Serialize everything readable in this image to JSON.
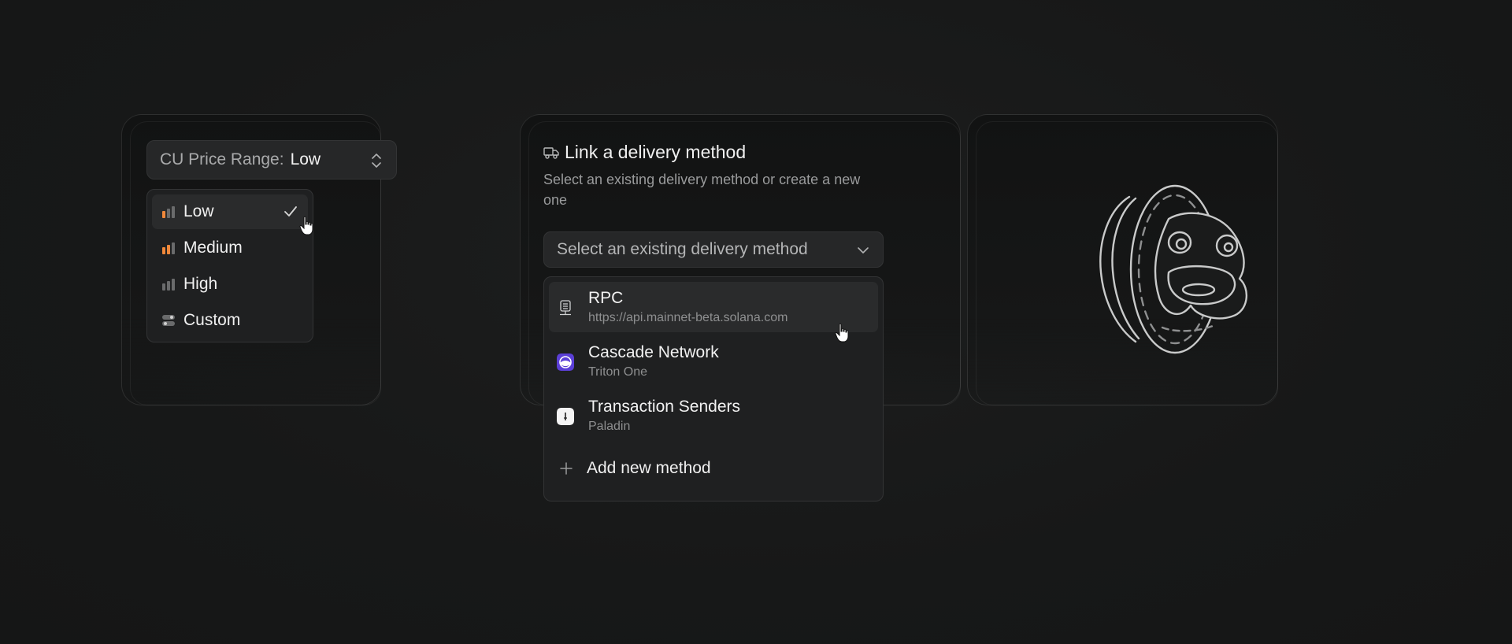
{
  "cu_price": {
    "label": "CU Price Range:",
    "value": "Low",
    "options": [
      {
        "label": "Low",
        "icon": "signal-bars-low-icon",
        "selected": true
      },
      {
        "label": "Medium",
        "icon": "signal-bars-medium-icon",
        "selected": false
      },
      {
        "label": "High",
        "icon": "signal-bars-high-icon",
        "selected": false
      },
      {
        "label": "Custom",
        "icon": "toggles-icon",
        "selected": false
      }
    ]
  },
  "delivery": {
    "title": "Link a delivery method",
    "subtitle": "Select an existing delivery method or create a new one",
    "placeholder": "Select an existing delivery method",
    "methods": [
      {
        "name": "RPC",
        "desc": "https://api.mainnet-beta.solana.com",
        "icon": "server-icon"
      },
      {
        "name": "Cascade Network",
        "desc": "Triton One",
        "icon": "cascade-icon"
      },
      {
        "name": "Transaction Senders",
        "desc": "Paladin",
        "icon": "paladin-icon"
      }
    ],
    "add_label": "Add new method"
  },
  "colors": {
    "accent_orange": "#f0883a",
    "background": "#171818",
    "panel": "#1f2021",
    "cascade_purple": "#6b46e0"
  }
}
